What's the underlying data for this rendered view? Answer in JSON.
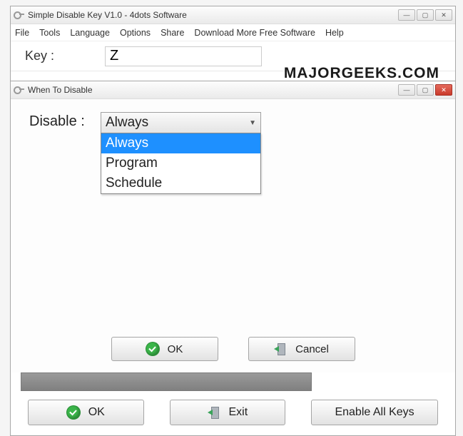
{
  "main_window": {
    "title": "Simple Disable Key V1.0 - 4dots Software",
    "menu": [
      "File",
      "Tools",
      "Language",
      "Options",
      "Share",
      "Download More Free Software",
      "Help"
    ],
    "key_label": "Key :",
    "key_value": "Z",
    "watermark": "MAJORGEEKS.COM",
    "controls": {
      "min": "—",
      "max": "▢",
      "close": "✕"
    },
    "buttons": {
      "ok": "OK",
      "exit": "Exit",
      "enable_all": "Enable All Keys"
    }
  },
  "dialog": {
    "title": "When To Disable",
    "disable_label": "Disable :",
    "selected": "Always",
    "options": [
      "Always",
      "Program",
      "Schedule"
    ],
    "buttons": {
      "ok": "OK",
      "cancel": "Cancel"
    },
    "controls": {
      "min": "—",
      "max": "▢",
      "close": "✕"
    }
  }
}
